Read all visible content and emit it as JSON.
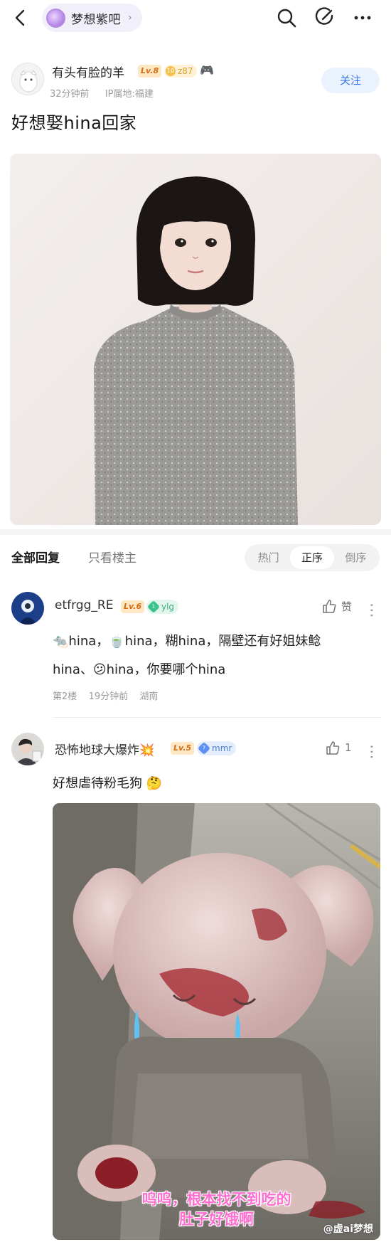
{
  "topbar": {
    "forum_name": "梦想紫吧",
    "icons": [
      "back-icon",
      "search-icon",
      "edit-icon",
      "more-icon"
    ]
  },
  "post": {
    "author": {
      "name": "有头有脸的羊",
      "level": "Lv.8",
      "gold_level": "10",
      "gold_value": "z87",
      "emoji": "🎮",
      "time": "32分钟前",
      "ip": "IP属地:福建"
    },
    "follow_label": "关注",
    "title": "好想娶hina回家"
  },
  "replies_bar": {
    "all_label": "全部回复",
    "op_only_label": "只看楼主",
    "sort_options": [
      "热门",
      "正序",
      "倒序"
    ],
    "active_sort": "正序"
  },
  "comments": [
    {
      "name": "etfrgg_RE",
      "level": "Lv.6",
      "tag_level": "1",
      "tag_text": "ylg",
      "like_label": "赞",
      "line1": "🐀hina，🍵hina，糊hina，隔壁还有好姐妹鲶",
      "line2": "hina、😕hina，你要哪个hina",
      "floor": "第2楼",
      "time": "19分钟前",
      "location": "湖南"
    },
    {
      "name": "恐怖地球大爆炸💥",
      "level": "Lv.5",
      "tag_level": "7",
      "tag_text": "mmr",
      "like_count": "1",
      "text": "好想虐待粉毛狗 🤔",
      "caption_line1": "呜呜，根本找不到吃的",
      "caption_line2": "肚子好饿啊",
      "watermark": "@虚ai梦想"
    }
  ],
  "colors": {
    "accent_blue": "#3a7be8",
    "level_orange": "#d76a12",
    "caption_pink": "#ff6fd1"
  }
}
